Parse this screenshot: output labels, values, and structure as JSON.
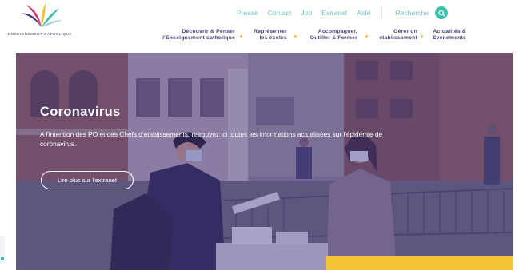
{
  "brand": {
    "logo_text": "ENSEIGNEMENT CATHOLIQUE"
  },
  "utility_nav": {
    "items": [
      "Presse",
      "Contact",
      "Job",
      "Extranet",
      "Aide"
    ],
    "search_label": "Recherche",
    "search_icon": "search-icon"
  },
  "main_nav": {
    "items": [
      {
        "line1": "Découvrir & Penser",
        "line2": "l'Enseignement catholique"
      },
      {
        "line1": "Représenter",
        "line2": "les écoles"
      },
      {
        "line1": "Accompagner,",
        "line2": "Outiller & Former"
      },
      {
        "line1": "Gérer un",
        "line2": "établissement"
      },
      {
        "line1": "Actualités &",
        "line2": "Evenements"
      }
    ]
  },
  "hero": {
    "title": "Coronavirus",
    "description": "A l'intention des PO et des Chefs d'établissements, retrouvez ici toutes les informations actualisées sur l'épidémie de coronavirus.",
    "cta_label": "Lire plus sur l'extranet"
  },
  "colors": {
    "brand_purple": "#4a3d7a",
    "accent_teal": "#6fc6c2",
    "accent_yellow": "#f6c338",
    "overlay": "#4e3e8c"
  }
}
